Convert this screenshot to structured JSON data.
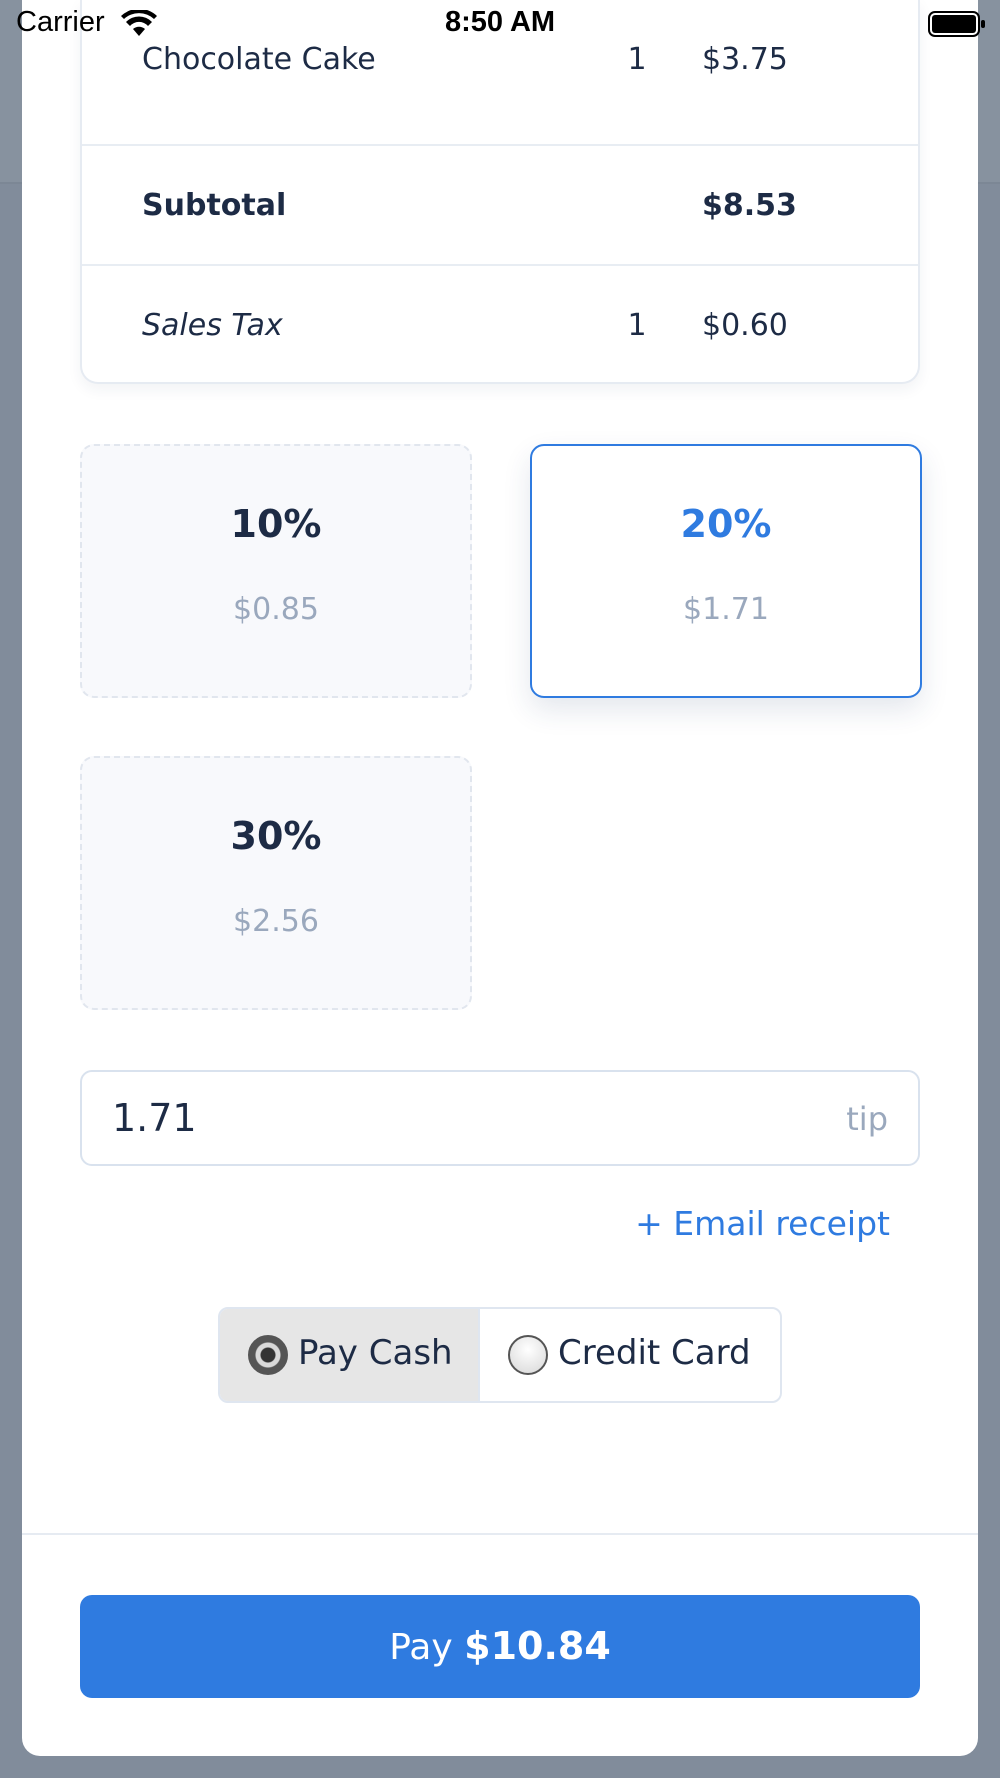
{
  "status_bar": {
    "carrier": "Carrier",
    "time": "8:50 AM"
  },
  "receipt": {
    "rows": [
      {
        "item": "Chocolate Cake",
        "qty": "1",
        "price": "$3.75"
      },
      {
        "item": "Subtotal",
        "qty": "",
        "price": "$8.53"
      },
      {
        "item": "Sales Tax",
        "qty": "1",
        "price": "$0.60"
      }
    ]
  },
  "tips": {
    "options": [
      {
        "percent": "10%",
        "amount": "$0.85",
        "selected": false
      },
      {
        "percent": "20%",
        "amount": "$1.71",
        "selected": true
      },
      {
        "percent": "30%",
        "amount": "$2.56",
        "selected": false
      }
    ],
    "input_value": "1.71",
    "input_suffix": "tip"
  },
  "email_receipt_label": "+ Email receipt",
  "payment_method": {
    "options": [
      "Pay Cash",
      "Credit Card"
    ],
    "selected": "Pay Cash"
  },
  "pay_button": {
    "label": "Pay",
    "amount": "$10.84"
  },
  "colors": {
    "accent": "#2f7be0",
    "text": "#1d2b45",
    "muted": "#9aa8bd"
  }
}
